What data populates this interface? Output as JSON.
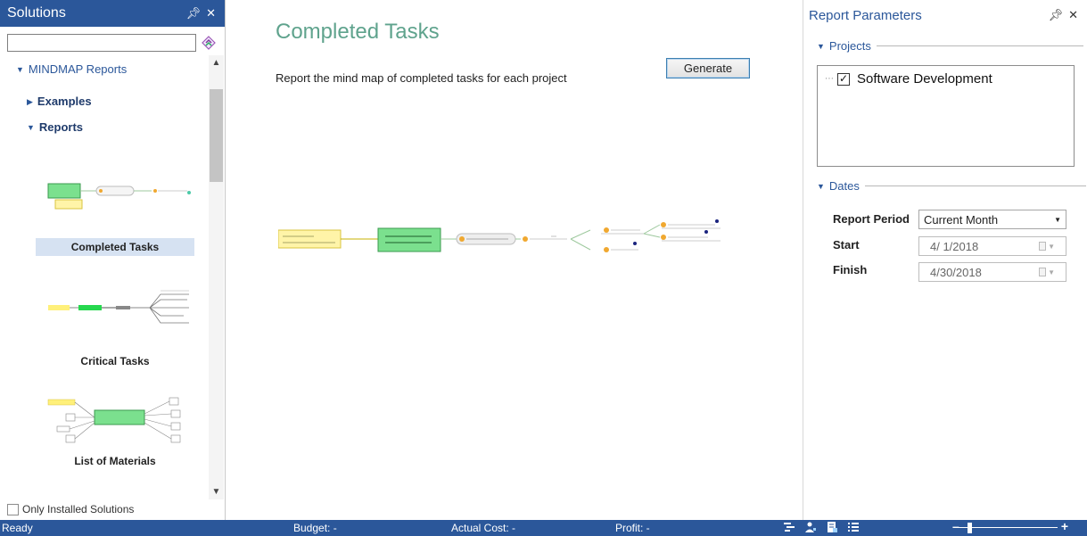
{
  "left_pane": {
    "title": "Solutions",
    "pin_icon": "pin-icon",
    "close_icon": "close-icon",
    "search": {
      "value": "",
      "placeholder": ""
    },
    "search_icon": "diamond-nav-icon",
    "tree": {
      "root_label": "MINDMAP Reports",
      "nodes": [
        {
          "label": "Examples",
          "expanded": false
        },
        {
          "label": "Reports",
          "expanded": true
        }
      ],
      "thumbnails": [
        {
          "label": "Completed Tasks",
          "selected": true
        },
        {
          "label": "Critical Tasks",
          "selected": false
        },
        {
          "label": "List of Materials",
          "selected": false
        }
      ]
    },
    "only_installed": {
      "label": "Only Installed Solutions",
      "checked": false
    }
  },
  "center": {
    "title": "Completed Tasks",
    "description": "Report the mind map of completed tasks for each project",
    "generate_label": "Generate"
  },
  "right_pane": {
    "title": "Report Parameters",
    "projects_header": "Projects",
    "projects": [
      {
        "label": "Software Development",
        "checked": true
      }
    ],
    "dates_header": "Dates",
    "report_period_label": "Report Period",
    "report_period_value": "Current Month",
    "start_label": "Start",
    "start_value": "4/ 1/2018",
    "finish_label": "Finish",
    "finish_value": "4/30/2018"
  },
  "status_bar": {
    "ready": "Ready",
    "budget": "Budget: -",
    "actual_cost": "Actual Cost: -",
    "profit": "Profit: -",
    "zoom_fraction": 0.08
  }
}
